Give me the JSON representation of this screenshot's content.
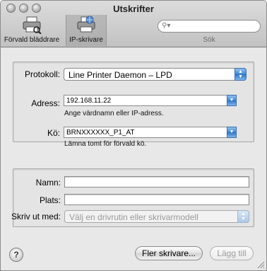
{
  "window": {
    "title": "Utskrifter"
  },
  "toolbar": {
    "default_browser_label": "Förvald bläddrare",
    "ip_printer_label": "IP-skrivare",
    "search_placeholder": "",
    "search_label": "Sök"
  },
  "connection": {
    "protocol_label": "Protokoll:",
    "protocol_value": "Line Printer Daemon – LPD",
    "address_label": "Adress:",
    "address_value": "192.168.11.22",
    "address_hint": "Ange värdnamn eller IP-adress.",
    "queue_label": "Kö:",
    "queue_value": "BRNXXXXXX_P1_AT",
    "queue_hint": "Lämna tomt för förvald kö."
  },
  "printer": {
    "name_label": "Namn:",
    "name_value": "",
    "location_label": "Plats:",
    "location_value": "",
    "print_using_label": "Skriv ut med:",
    "print_using_value": "Välj en drivrutin eller skrivarmodell"
  },
  "footer": {
    "help_label": "?",
    "more_printers_label": "Fler skrivare...",
    "add_label": "Lägg till"
  },
  "colors": {
    "accent_blue": "#3d87d8",
    "window_bg": "#e8e8e8",
    "disabled_text": "#9a9a9a"
  }
}
